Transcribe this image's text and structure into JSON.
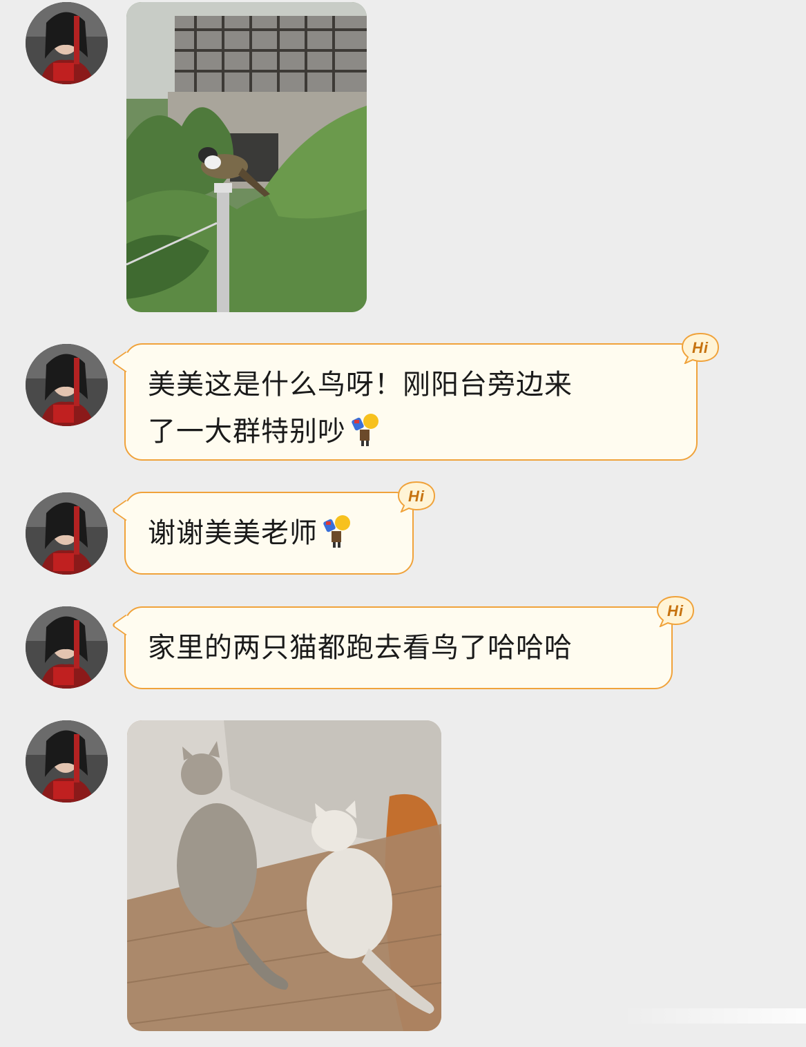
{
  "chat": {
    "messages": [
      {
        "type": "image",
        "image_icon": "bird-on-pole-photo",
        "description": ""
      },
      {
        "type": "text",
        "text_line1": "美美这是什么鸟呀！刚阳台旁边来",
        "text_line2": "了一大群特别吵",
        "sticker": "bowing-figure-emoji",
        "badge": "Hi"
      },
      {
        "type": "text",
        "text": "谢谢美美老师",
        "sticker": "bowing-figure-emoji",
        "badge": "Hi"
      },
      {
        "type": "text",
        "text": "家里的两只猫都跑去看鸟了哈哈哈",
        "badge": "Hi"
      },
      {
        "type": "image",
        "image_icon": "two-cats-photo"
      }
    ]
  },
  "colors": {
    "background": "#ededed",
    "bubble_fill": "#fffcf0",
    "bubble_border": "#f0a23a",
    "badge_text": "#c6720f"
  }
}
